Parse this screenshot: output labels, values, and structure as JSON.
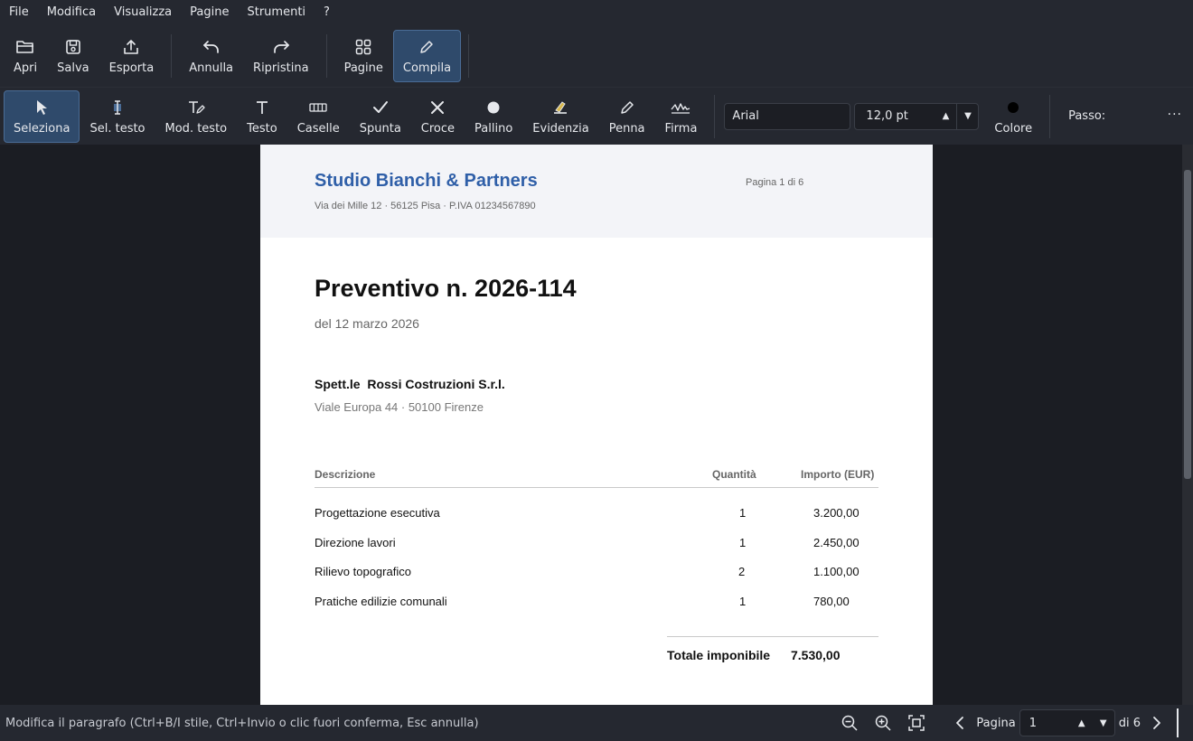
{
  "menu": [
    "File",
    "Modifica",
    "Visualizza",
    "Pagine",
    "Strumenti",
    "?"
  ],
  "toolbar": {
    "open": "Apri",
    "save": "Salva",
    "export": "Esporta",
    "undo": "Annulla",
    "redo": "Ripristina",
    "pages": "Pagine",
    "fill": "Compila"
  },
  "tools": {
    "select": "Seleziona",
    "select_text": "Sel. testo",
    "edit_text": "Mod. testo",
    "text": "Testo",
    "boxes": "Caselle",
    "check": "Spunta",
    "cross": "Croce",
    "dot": "Pallino",
    "highlight": "Evidenzia",
    "pen": "Penna",
    "signature": "Firma",
    "font": "Arial",
    "font_size": "12,0 pt",
    "color_label": "Colore",
    "color_value": "#000000",
    "step_label": "Passo:",
    "more": "···"
  },
  "document": {
    "company": "Studio Bianchi & Partners",
    "company_sub": "Via dei Mille 12 · 56125 Pisa · P.IVA 01234567890",
    "page_indicator": "Pagina 1 di 6",
    "title": "Preventivo n. 2026-114",
    "date": "del 12 marzo 2026",
    "recipient": "Spett.le  Rossi Costruzioni S.r.l.",
    "recipient_address": "Viale Europa 44 · 50100 Firenze",
    "table": {
      "headers": [
        "Descrizione",
        "Quantità",
        "Importo (EUR)"
      ],
      "rows": [
        [
          "Progettazione esecutiva",
          "1",
          "3.200,00"
        ],
        [
          "Direzione lavori",
          "1",
          "2.450,00"
        ],
        [
          "Rilievo topografico",
          "2",
          "1.100,00"
        ],
        [
          "Pratiche edilizie comunali",
          "1",
          "780,00"
        ]
      ]
    },
    "total_label": "Totale imponibile",
    "total_value": "7.530,00"
  },
  "status": {
    "hint": "Modifica il paragrafo (Ctrl+B/I stile, Ctrl+Invio o clic fuori conferma, Esc annulla)",
    "page_label": "Pagina",
    "page_value": "1",
    "page_total": "di 6"
  },
  "colors": {
    "accent_active": "#2f4a6b",
    "brand": "#2f5fa8",
    "background": "#1b1d23"
  }
}
